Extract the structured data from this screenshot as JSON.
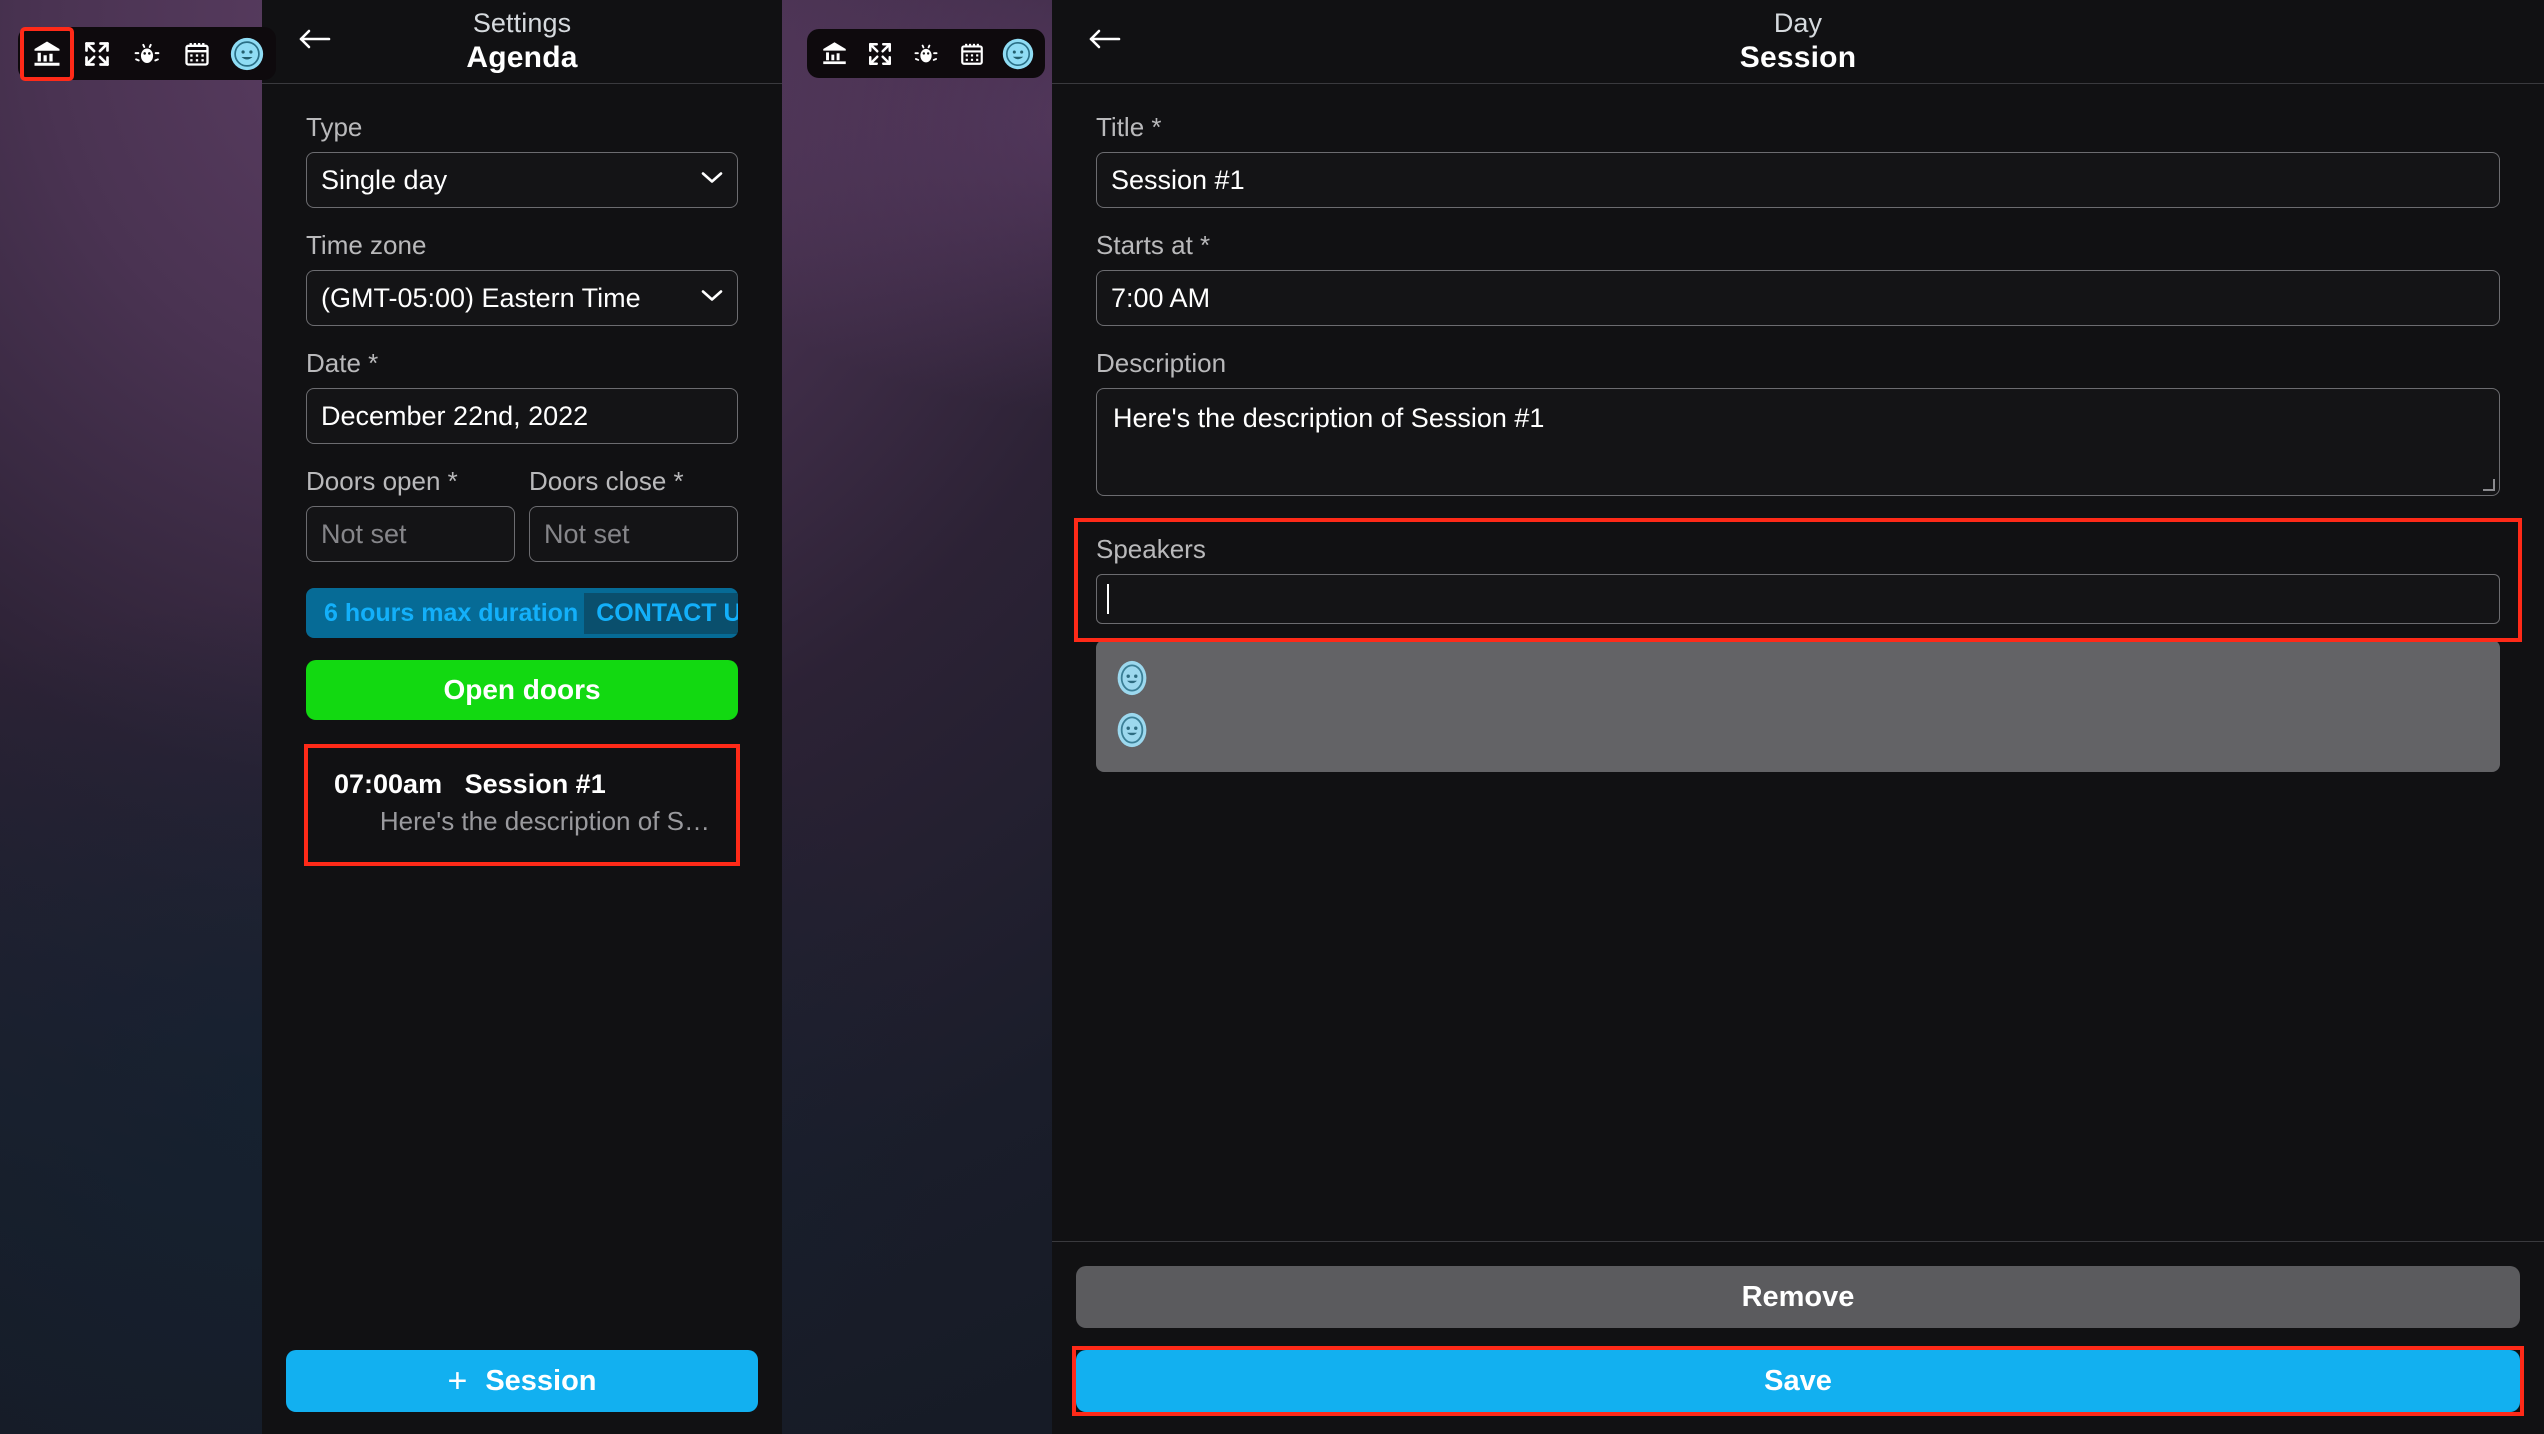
{
  "toolbar": {
    "icons": [
      {
        "name": "home-bank-icon",
        "label": "Home"
      },
      {
        "name": "expand-fullscreen-icon",
        "label": "Fullscreen"
      },
      {
        "name": "bug-debug-icon",
        "label": "Debug"
      },
      {
        "name": "calendar-icon",
        "label": "Calendar"
      },
      {
        "name": "avatar-face-icon",
        "label": "Profile"
      }
    ],
    "selected_index": 0,
    "highlight_color": "#ff2a18"
  },
  "agenda_panel": {
    "header": {
      "back_label": "Back",
      "subtitle": "Settings",
      "title": "Agenda"
    },
    "type": {
      "label": "Type",
      "value": "Single day"
    },
    "timezone": {
      "label": "Time zone",
      "value": "(GMT-05:00) Eastern Time"
    },
    "date": {
      "label": "Date *",
      "value": "December 22nd, 2022"
    },
    "doors_open": {
      "label": "Doors open *",
      "placeholder": "Not set"
    },
    "doors_close": {
      "label": "Doors close *",
      "placeholder": "Not set"
    },
    "banner": {
      "text": "6 hours max duration",
      "cta": "CONTACT US"
    },
    "open_doors_button": "Open doors",
    "session_item": {
      "time": "07:00am",
      "title": "Session #1",
      "description": "Here's the description of S…"
    },
    "add_session_button": {
      "plus": "+",
      "label": "Session"
    }
  },
  "session_panel": {
    "header": {
      "back_label": "Back",
      "subtitle": "Day",
      "title": "Session"
    },
    "title_field": {
      "label": "Title *",
      "value": "Session #1"
    },
    "starts_at": {
      "label": "Starts at *",
      "value": "7:00 AM"
    },
    "description": {
      "label": "Description",
      "value": "Here's the description of Session #1"
    },
    "speakers": {
      "label": "Speakers",
      "value": "",
      "options": [
        {
          "name": "speaker-option",
          "avatar": "avatar-face-icon"
        },
        {
          "name": "speaker-option",
          "avatar": "avatar-face-icon"
        }
      ]
    },
    "remove_button": "Remove",
    "save_button": "Save"
  }
}
